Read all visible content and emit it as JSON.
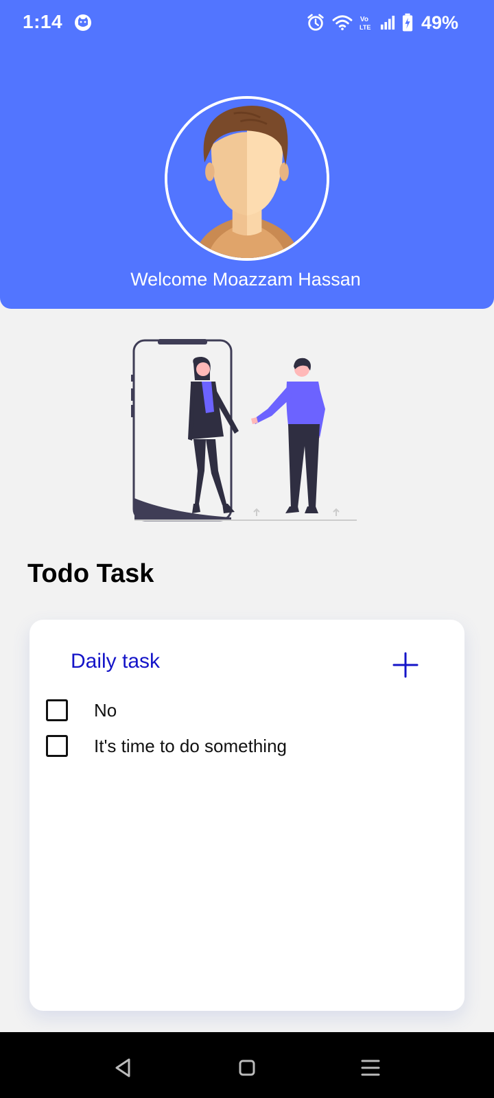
{
  "status_bar": {
    "time": "1:14",
    "battery": "49%",
    "icons": [
      "cat-app-icon",
      "alarm-icon",
      "wifi-icon",
      "volte-icon",
      "signal-icon",
      "battery-charging-icon"
    ]
  },
  "header": {
    "welcome_text": "Welcome Moazzam Hassan",
    "background_color": "#5275ff",
    "avatar_icon": "user-avatar"
  },
  "illustration": {
    "icon": "people-phone-illustration"
  },
  "section": {
    "title": "Todo Task"
  },
  "card": {
    "title": "Daily task",
    "add_icon": "plus-icon",
    "accent_color": "#1414c8",
    "tasks": [
      {
        "text": "No",
        "checked": false
      },
      {
        "text": "It's time to do something",
        "checked": false
      }
    ]
  },
  "nav_bar": {
    "buttons": [
      "back-icon",
      "home-icon",
      "recents-icon"
    ]
  }
}
